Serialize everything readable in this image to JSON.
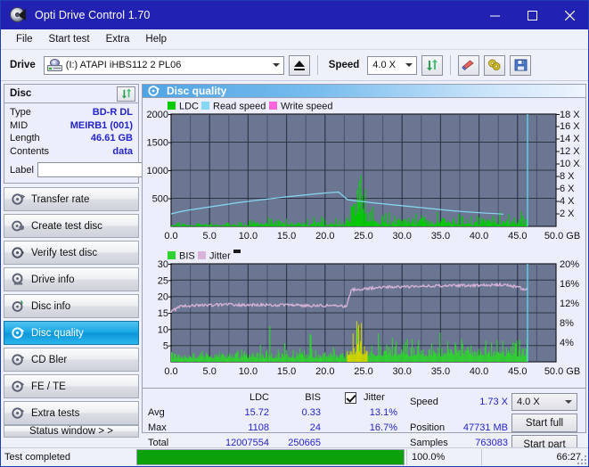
{
  "window": {
    "title": "Opti Drive Control 1.70",
    "minimize_label": "Minimize",
    "maximize_label": "Maximize",
    "close_label": "Close"
  },
  "menu": {
    "items": [
      {
        "label": "File"
      },
      {
        "label": "Start test"
      },
      {
        "label": "Extra"
      },
      {
        "label": "Help"
      }
    ]
  },
  "toolbar": {
    "drive_label": "Drive",
    "drive_value": "(I:)   ATAPI iHBS112   2 PL06",
    "eject_label": "Eject",
    "speed_label": "Speed",
    "speed_value": "4.0 X",
    "refresh_label": "Refresh",
    "erase_label": "Erase disc",
    "settings_label": "Settings",
    "save_label": "Save"
  },
  "disc_panel": {
    "title": "Disc",
    "refresh_label": "Refresh disc info",
    "rows": [
      {
        "key": "Type",
        "value": "BD-R DL"
      },
      {
        "key": "MID",
        "value": "MEIRB1 (001)"
      },
      {
        "key": "Length",
        "value": "46.61 GB"
      },
      {
        "key": "Contents",
        "value": "data"
      }
    ],
    "label_key": "Label",
    "label_value": "",
    "label_placeholder": ""
  },
  "nav": {
    "items": [
      {
        "label": "Transfer rate",
        "icon": "disc-transfer-icon",
        "active": false
      },
      {
        "label": "Create test disc",
        "icon": "disc-create-icon",
        "active": false
      },
      {
        "label": "Verify test disc",
        "icon": "disc-verify-icon",
        "active": false
      },
      {
        "label": "Drive info",
        "icon": "disc-drive-icon",
        "active": false
      },
      {
        "label": "Disc info",
        "icon": "disc-info-icon",
        "active": false
      },
      {
        "label": "Disc quality",
        "icon": "disc-quality-icon",
        "active": true
      },
      {
        "label": "CD Bler",
        "icon": "disc-bler-icon",
        "active": false
      },
      {
        "label": "FE / TE",
        "icon": "disc-fete-icon",
        "active": false
      },
      {
        "label": "Extra tests",
        "icon": "disc-extra-icon",
        "active": false
      }
    ],
    "status_window_label": "Status window > >"
  },
  "panel": {
    "title": "Disc quality"
  },
  "stats": {
    "columns": [
      "LDC",
      "BIS"
    ],
    "col_ldc": "LDC",
    "col_bis": "BIS",
    "jitter_label": "Jitter",
    "jitter_checked": true,
    "rows": [
      {
        "label": "Avg",
        "ldc": "15.72",
        "bis": "0.33",
        "jitter": "13.1%"
      },
      {
        "label": "Max",
        "ldc": "1108",
        "bis": "24",
        "jitter": "16.7%"
      },
      {
        "label": "Total",
        "ldc": "12007554",
        "bis": "250665",
        "jitter": ""
      }
    ],
    "row_avg_label": "Avg",
    "row_max_label": "Max",
    "row_total_label": "Total",
    "speed_label": "Speed",
    "speed_value": "1.73 X",
    "position_label": "Position",
    "position_value": "47731 MB",
    "samples_label": "Samples",
    "samples_value": "763083",
    "speed_select_value": "4.0 X",
    "start_full_label": "Start full",
    "start_part_label": "Start part"
  },
  "statusbar": {
    "text": "Test completed",
    "progress_percent": "100.0%",
    "progress_value": 100,
    "elapsed": "66:27"
  },
  "colors": {
    "ldc_green": "#00cc00",
    "bis_green": "#2fd32f",
    "read_speed": "#87d7f2",
    "write_speed": "#ff66dd",
    "jitter_pink": "#d9b3d9",
    "jitter_spike": "#d4d400",
    "plot_bg": "#6b7792",
    "accent_blue": "#2424c8",
    "titlebar": "#2222b2",
    "progress": "#0aa10a"
  },
  "chart_data": [
    {
      "type": "area",
      "name": "disc-quality-ldc-chart",
      "title": "",
      "xlabel": "GB",
      "ylabel": "",
      "x": [
        0.0,
        50.0
      ],
      "xlim": [
        0.0,
        50.0
      ],
      "xticks": [
        "0.0",
        "5.0",
        "10.0",
        "15.0",
        "20.0",
        "25.0",
        "30.0",
        "35.0",
        "40.0",
        "45.0",
        "50.0 GB"
      ],
      "ylim": [
        0,
        2000
      ],
      "yticks": [
        "500",
        "1000",
        "1500",
        "2000"
      ],
      "y2lim": [
        0,
        18
      ],
      "y2ticks": [
        "2 X",
        "4 X",
        "6 X",
        "8 X",
        "10 X",
        "12 X",
        "14 X",
        "16 X",
        "18 X"
      ],
      "grid": true,
      "legend": [
        "LDC",
        "Read speed",
        "Write speed"
      ],
      "legend_position": "top-left",
      "series": [
        {
          "name": "LDC",
          "color": "#00cc00",
          "kind": "spikes",
          "note": "Dense low error baseline ~20-120 across disc, large cluster of spikes at 23-26 GB peaking near 1100, elevated noise 24-47 GB, data ends at 46.6 GB",
          "peak_value": 1108,
          "peak_position_gb": 24.2,
          "avg_value": 15.72
        },
        {
          "name": "Read speed",
          "color": "#87d7f2",
          "kind": "line",
          "note": "CAV ramp from ~2.0X at 0 GB rising to ~4.2X at 24 GB then stepping down to ~2.0X at 46.6 GB",
          "points": [
            [
              0,
              2.0
            ],
            [
              5,
              2.6
            ],
            [
              10,
              3.1
            ],
            [
              15,
              3.5
            ],
            [
              20,
              3.9
            ],
            [
              24,
              4.25
            ],
            [
              28,
              3.9
            ],
            [
              32,
              3.4
            ],
            [
              36,
              3.0
            ],
            [
              40,
              2.6
            ],
            [
              44,
              2.2
            ],
            [
              46.6,
              2.0
            ]
          ]
        },
        {
          "name": "Write speed",
          "color": "#ff66dd",
          "kind": "line",
          "note": "not plotted"
        }
      ],
      "marker_line_gb": 46.8
    },
    {
      "type": "area",
      "name": "disc-quality-bis-jitter-chart",
      "title": "",
      "xlabel": "GB",
      "ylabel": "",
      "xlim": [
        0.0,
        50.0
      ],
      "xticks": [
        "0.0",
        "5.0",
        "10.0",
        "15.0",
        "20.0",
        "25.0",
        "30.0",
        "35.0",
        "40.0",
        "45.0",
        "50.0 GB"
      ],
      "ylim": [
        0,
        30
      ],
      "yticks": [
        "5",
        "10",
        "15",
        "20",
        "25",
        "30"
      ],
      "y2lim": [
        0,
        20
      ],
      "y2ticks": [
        "4%",
        "8%",
        "12%",
        "16%",
        "20%"
      ],
      "grid": true,
      "legend": [
        "BIS",
        "Jitter"
      ],
      "legend_position": "top-left",
      "series": [
        {
          "name": "BIS",
          "color": "#2fd32f",
          "kind": "spikes",
          "note": "Low baseline ~1-3 across disc with scattered spikes to 5-11, heavy cluster 23-26 GB reaching 15+",
          "peak_value": 24,
          "avg_value": 0.33
        },
        {
          "name": "Jitter",
          "color": "#d9b3d9",
          "kind": "line",
          "note": "Starts ~15.5 (10.3%) rises to ~17.5 (11.7%) plateau to 22 GB, step up at 23 GB to ~22.5 (15%), slowly rising to ~23.5 (15.7%) by 44 GB then dipping to ~22 at end",
          "avg_percent": "13.1%",
          "max_percent": "16.7%"
        }
      ],
      "marker_line_gb": 46.8
    }
  ]
}
